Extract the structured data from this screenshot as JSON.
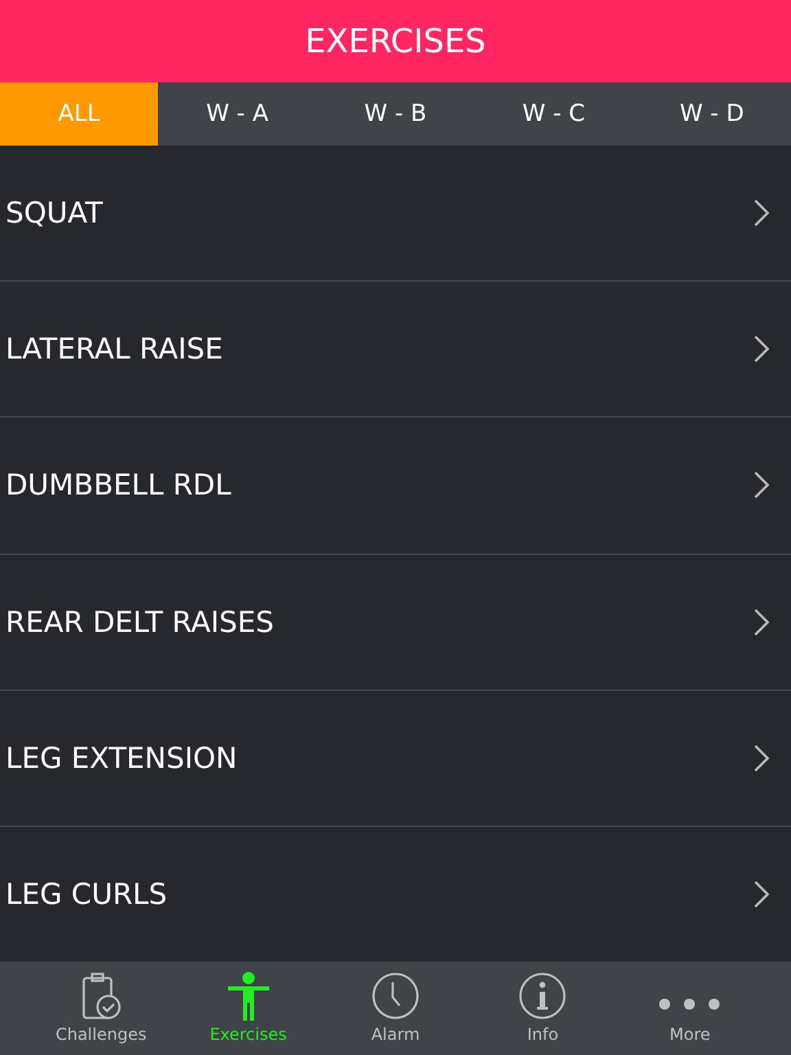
{
  "header": {
    "title": "EXERCISES"
  },
  "filters": [
    {
      "label": "ALL",
      "selected": true
    },
    {
      "label": "W - A",
      "selected": false
    },
    {
      "label": "W - B",
      "selected": false
    },
    {
      "label": "W - C",
      "selected": false
    },
    {
      "label": "W - D",
      "selected": false
    }
  ],
  "exercises": [
    {
      "name": "SQUAT"
    },
    {
      "name": "LATERAL RAISE"
    },
    {
      "name": "DUMBBELL RDL"
    },
    {
      "name": "REAR DELT RAISES"
    },
    {
      "name": "LEG EXTENSION"
    },
    {
      "name": "LEG CURLS"
    }
  ],
  "tab_bar": [
    {
      "kind": "clipboard",
      "label": "Challenges",
      "selected": false
    },
    {
      "kind": "figure",
      "label": "Exercises",
      "selected": true
    },
    {
      "kind": "clock",
      "label": "Alarm",
      "selected": false
    },
    {
      "kind": "info",
      "label": "Info",
      "selected": false
    },
    {
      "kind": "more",
      "label": "More",
      "selected": false
    }
  ]
}
